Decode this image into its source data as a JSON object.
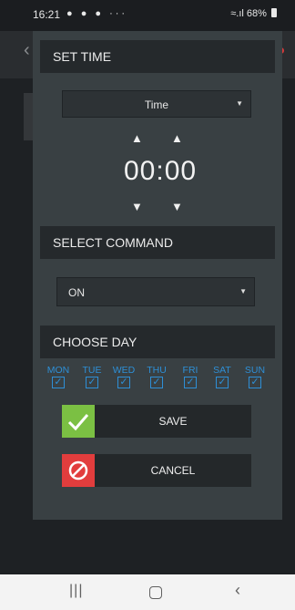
{
  "status_bar": {
    "time": "16:21",
    "icons_left": "⬦ ⬦ ⬦ ···",
    "battery": "68%"
  },
  "schedule_dialog": {
    "set_time": {
      "header": "SET TIME",
      "mode_select": {
        "value": "Time"
      },
      "hours": "00",
      "separator": ":",
      "minutes": "00"
    },
    "select_command": {
      "header": "SELECT COMMAND",
      "command_select": {
        "value": "ON"
      }
    },
    "choose_day": {
      "header": "CHOOSE DAY",
      "days": [
        {
          "label": "MON",
          "checked": true
        },
        {
          "label": "TUE",
          "checked": true
        },
        {
          "label": "WED",
          "checked": true
        },
        {
          "label": "THU",
          "checked": true
        },
        {
          "label": "FRI",
          "checked": true
        },
        {
          "label": "SAT",
          "checked": true
        },
        {
          "label": "SUN",
          "checked": true
        }
      ]
    },
    "save_button": {
      "label": "SAVE"
    },
    "cancel_button": {
      "label": "CANCEL"
    }
  },
  "colors": {
    "accent_blue": "#2e8fd6",
    "save_green": "#7bc043",
    "cancel_red": "#e23d3d"
  },
  "icons": [
    "back-arrow-icon",
    "notification-dot-icon",
    "up-arrow-icon",
    "down-arrow-icon",
    "checkmark-icon",
    "cancel-circle-icon",
    "recents-icon",
    "home-icon",
    "back-nav-icon"
  ]
}
